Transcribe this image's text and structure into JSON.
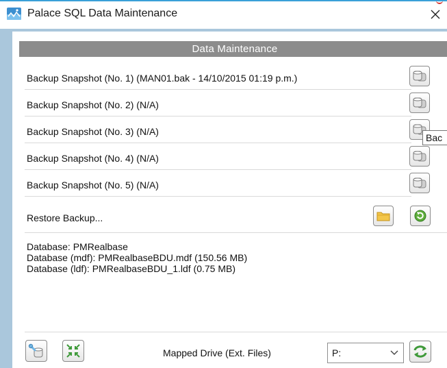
{
  "window": {
    "title": "Palace SQL Data Maintenance",
    "accent_color": "#3aa0d8",
    "icons": {
      "app": "palace-logo-icon",
      "close": "close-icon"
    }
  },
  "section": {
    "header": "Data Maintenance",
    "header_color": "#8c8c8c"
  },
  "backups": [
    {
      "label": "Backup Snapshot (No. 1) (MAN01.bak - 14/10/2015 01:19 p.m.)",
      "icon": "database-icon"
    },
    {
      "label": "Backup Snapshot (No. 2) (N/A)",
      "icon": "database-icon"
    },
    {
      "label": "Backup Snapshot (No. 3) (N/A)",
      "icon": "database-icon"
    },
    {
      "label": "Backup Snapshot (No. 4) (N/A)",
      "icon": "database-icon"
    },
    {
      "label": "Backup Snapshot (No. 5) (N/A)",
      "icon": "database-icon"
    }
  ],
  "tooltip": {
    "text": "Bac"
  },
  "restore": {
    "label": "Restore Backup...",
    "icons": [
      "folder-icon",
      "restore-arrow-icon"
    ]
  },
  "info": {
    "database": "Database: PMRealbase",
    "mdf": "Database (mdf): PMRealbaseBDU.mdf (150.56 MB)",
    "ldf": "Database (ldf): PMRealbaseBDU_1.ldf (0.75 MB)"
  },
  "footer": {
    "mapped_drive_label": "Mapped Drive (Ext. Files)",
    "drive_value": "P:",
    "icons": [
      "database-settings-icon",
      "shrink-icon",
      "refresh-icon"
    ]
  }
}
